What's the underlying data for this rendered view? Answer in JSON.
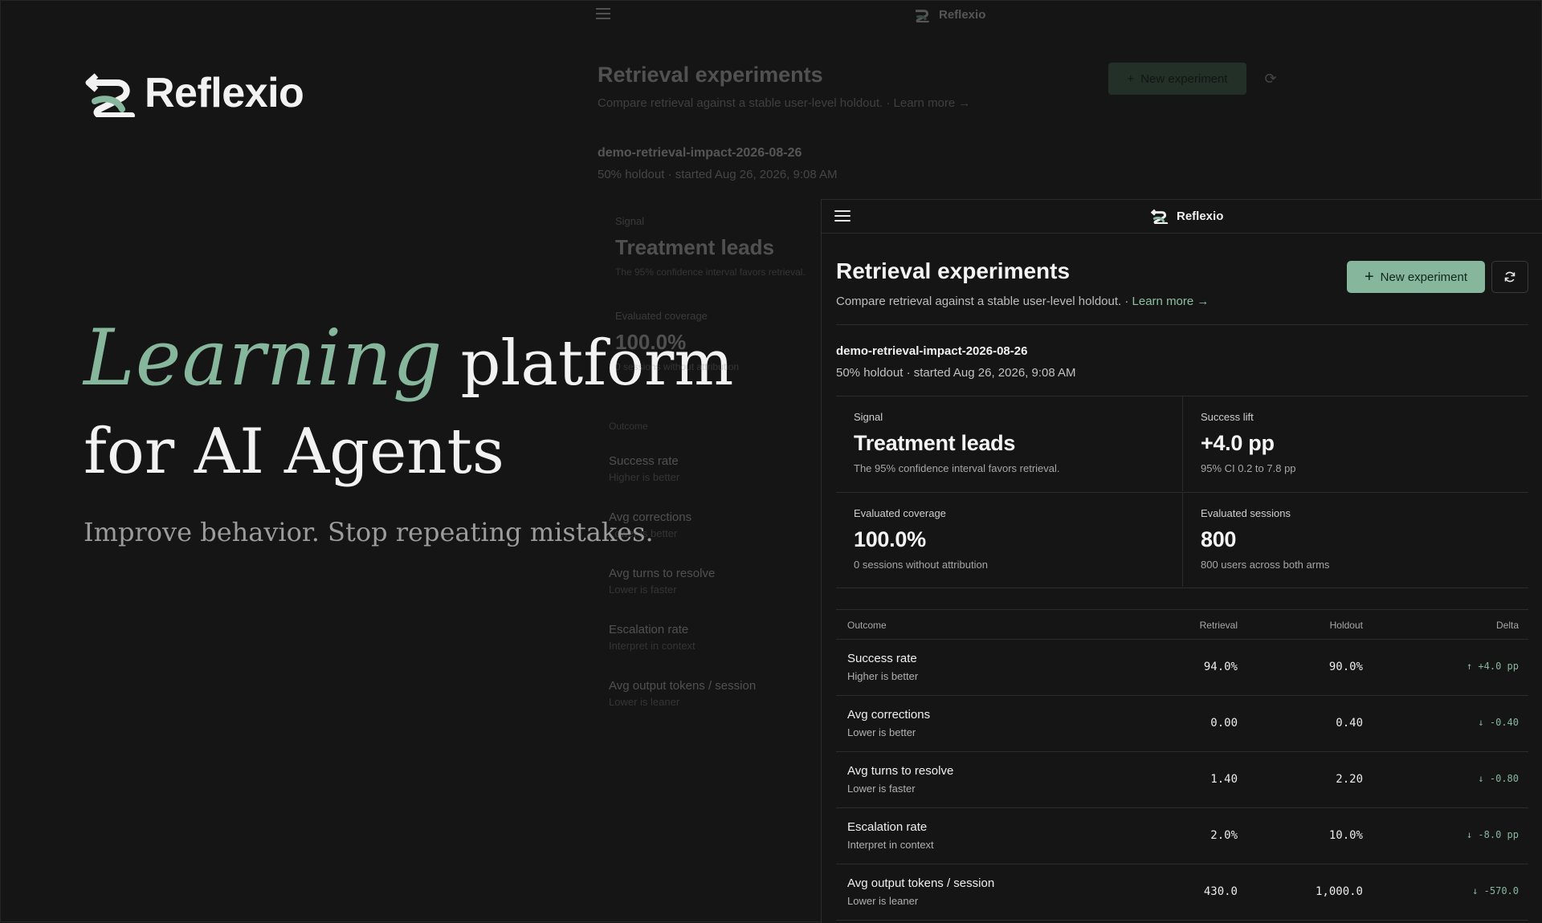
{
  "brand": {
    "name": "Reflexio"
  },
  "hero": {
    "accent_word": "Learning",
    "line1_rest": "platform",
    "line2": "for AI Agents",
    "subtitle": "Improve behavior. Stop repeating mistakes."
  },
  "app": {
    "brand_name": "Reflexio",
    "title": "Retrieval experiments",
    "subtitle": "Compare retrieval against a stable user-level holdout. ·",
    "learn_more": "Learn more →",
    "new_experiment_label": "New experiment",
    "experiment": {
      "name": "demo-retrieval-impact-2026-08-26",
      "meta": "50% holdout · started Aug 26, 2026, 9:08 AM"
    },
    "stats": [
      {
        "label": "Signal",
        "value": "Treatment leads",
        "desc": "The 95% confidence interval favors retrieval."
      },
      {
        "label": "Success lift",
        "value": "+4.0 pp",
        "desc": "95% CI 0.2 to 7.8 pp"
      },
      {
        "label": "Evaluated coverage",
        "value": "100.0%",
        "desc": "0 sessions without attribution"
      },
      {
        "label": "Evaluated sessions",
        "value": "800",
        "desc": "800 users across both arms"
      }
    ],
    "table": {
      "headers": {
        "outcome": "Outcome",
        "retrieval": "Retrieval",
        "holdout": "Holdout",
        "delta": "Delta"
      },
      "rows": [
        {
          "name": "Success rate",
          "hint": "Higher is better",
          "retrieval": "94.0%",
          "holdout": "90.0%",
          "delta": "↑ +4.0 pp"
        },
        {
          "name": "Avg corrections",
          "hint": "Lower is better",
          "retrieval": "0.00",
          "holdout": "0.40",
          "delta": "↓ -0.40"
        },
        {
          "name": "Avg turns to resolve",
          "hint": "Lower is faster",
          "retrieval": "1.40",
          "holdout": "2.20",
          "delta": "↓ -0.80"
        },
        {
          "name": "Escalation rate",
          "hint": "Interpret in context",
          "retrieval": "2.0%",
          "holdout": "10.0%",
          "delta": "↓ -8.0 pp"
        },
        {
          "name": "Avg output tokens / session",
          "hint": "Lower is leaner",
          "retrieval": "430.0",
          "holdout": "1,000.0",
          "delta": "↓ -570.0"
        }
      ]
    }
  },
  "colors": {
    "accent": "#86b79d",
    "background": "#151515",
    "text": "#ececec"
  },
  "icons": {
    "logo": "reflexio-logo-icon",
    "menu": "hamburger-menu-icon",
    "refresh": "refresh-icon",
    "plus": "plus-icon"
  }
}
